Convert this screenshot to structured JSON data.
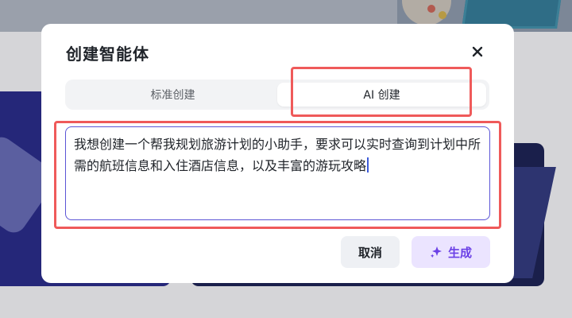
{
  "dialog": {
    "title": "创建智能体",
    "close_icon": "close-icon"
  },
  "tabs": [
    {
      "label": "标准创建",
      "active": false
    },
    {
      "label": "AI 创建",
      "active": true
    }
  ],
  "prompt": {
    "value": "我想创建一个帮我规划旅游计划的小助手，要求可以实时查询到计划中所需的航班信息和入住酒店信息，以及丰富的游玩攻略"
  },
  "buttons": {
    "cancel_label": "取消",
    "generate_label": "生成",
    "generate_icon": "sparkle-icon"
  },
  "colors": {
    "accent": "#6b40e6",
    "input_border": "#5b55d6",
    "annotation": "#ef5a5a"
  }
}
